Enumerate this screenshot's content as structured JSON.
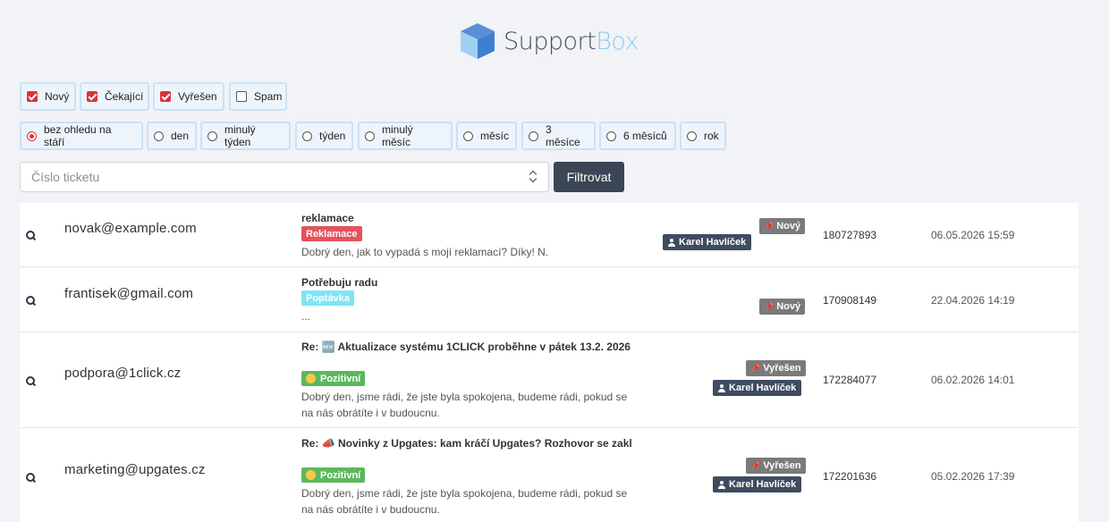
{
  "brand": {
    "word1": "Support",
    "word2": "Box"
  },
  "status_filters": [
    {
      "label": "Nový",
      "checked": true
    },
    {
      "label": "Čekající",
      "checked": true
    },
    {
      "label": "Vyřešen",
      "checked": true
    },
    {
      "label": "Spam",
      "checked": false
    }
  ],
  "age_filters": [
    {
      "label": "bez ohledu na stáří",
      "selected": true
    },
    {
      "label": "den",
      "selected": false
    },
    {
      "label": "minulý týden",
      "selected": false
    },
    {
      "label": "týden",
      "selected": false
    },
    {
      "label": "minulý měsíc",
      "selected": false
    },
    {
      "label": "měsíc",
      "selected": false
    },
    {
      "label": "3 měsíce",
      "selected": false
    },
    {
      "label": "6 měsíců",
      "selected": false
    },
    {
      "label": "rok",
      "selected": false
    }
  ],
  "search": {
    "placeholder": "Číslo ticketu",
    "value": ""
  },
  "filter_button": "Filtrovat",
  "tickets": [
    {
      "email": "novak@example.com",
      "subject": "reklamace",
      "tag": "Reklamace",
      "preview": "Dobrý den, jak to vypadá s mojí reklamací? Díky! N.",
      "status": "Nový",
      "agent": "Karel Havlíček",
      "number": "180727893",
      "date": "06.05.2026 15:59"
    },
    {
      "email": "frantisek@gmail.com",
      "subject": "Potřebuju radu",
      "tag": "Poptávka",
      "preview": "...",
      "status": "Nový",
      "agent": "",
      "number": "170908149",
      "date": "22.04.2026 14:19"
    },
    {
      "email": "podpora@1click.cz",
      "subject": "Re: 🆕 Aktualizace systému 1CLICK proběhne v pátek 13.2. 2026",
      "tag": "Pozitivní",
      "preview": "Dobrý den, jsme rádi, že jste byla spokojena, budeme rádi, pokud se na nás obrátíte i v budoucnu.",
      "status": "Vyřešen",
      "agent": "Karel Havlíček",
      "number": "172284077",
      "date": "06.02.2026 14:01"
    },
    {
      "email": "marketing@upgates.cz",
      "subject": "Re: 📣 Novinky z Upgates: kam kráčí Upgates? Rozhovor se zakl",
      "tag": "Pozitivní",
      "preview": "Dobrý den, jsme rádi, že jste byla spokojena, budeme rádi, pokud se na nás obrátíte i v budoucnu.",
      "status": "Vyřešen",
      "agent": "Karel Havlíček",
      "number": "172201636",
      "date": "05.02.2026 17:39"
    }
  ],
  "colors": {
    "accent_red": "#d9353b",
    "tag_reklamace": "#e5525b",
    "tag_poptavka": "#7ce6f5",
    "tag_pozitivni": "#5cb85c",
    "status_badge": "#7a7a7a",
    "agent_badge": "#3f4b5f",
    "button": "#3a4556"
  },
  "icons": {
    "logo": "cube-logo-icon",
    "checkbox": "checkbox-icon",
    "radio": "radio-icon",
    "stepper": "stepper-icon",
    "row_open": "search-icon",
    "status": "pin-icon",
    "agent": "user-icon"
  }
}
